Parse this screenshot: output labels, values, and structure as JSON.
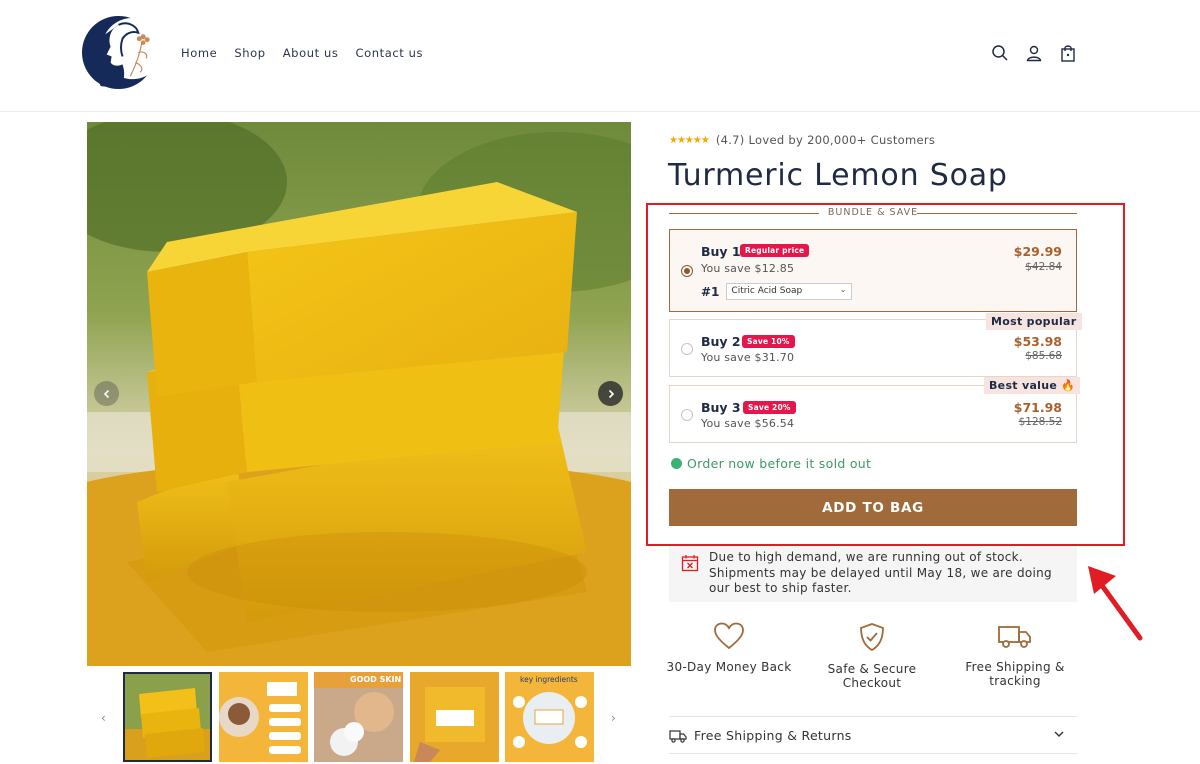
{
  "header": {
    "nav": [
      "Home",
      "Shop",
      "About us",
      "Contact us"
    ],
    "icons": [
      "search-icon",
      "account-icon",
      "bag-icon"
    ]
  },
  "product": {
    "rating": "(4.7) Loved by 200,000+ Customers",
    "stars": "★★★★★",
    "title": "Turmeric Lemon Soap"
  },
  "bundle": {
    "header": "BUNDLE & SAVE",
    "options": [
      {
        "name": "Buy 1",
        "badge": "Regular price",
        "save": "You save $12.85",
        "price": "$29.99",
        "old_price": "$42.84",
        "selected": true,
        "variant_num": "#1",
        "variant_value": "Citric Acid Soap"
      },
      {
        "name": "Buy 2",
        "badge": "Save 10%",
        "save": "You save $31.70",
        "price": "$53.98",
        "old_price": "$85.68",
        "tag": "Most popular"
      },
      {
        "name": "Buy 3",
        "badge": "Save 20%",
        "save": "You save $56.54",
        "price": "$71.98",
        "old_price": "$128.52",
        "tag": "Best value 🔥"
      }
    ]
  },
  "stock_text": "Order now before it sold out",
  "add_to_bag": "ADD TO BAG",
  "notice": "Due to high demand, we are running out of stock. Shipments may be delayed until May 18, we are doing our best to ship faster.",
  "features": [
    {
      "label": "30-Day Money Back",
      "icon": "heart-icon"
    },
    {
      "label": "Safe & Secure Checkout",
      "icon": "shield-check-icon"
    },
    {
      "label": "Free Shipping & tracking",
      "icon": "truck-icon"
    }
  ],
  "accordion": {
    "label": "Free Shipping & Returns"
  },
  "thumbnails": {
    "labels": [
      "GOOD SKIN",
      "key ingredients"
    ]
  },
  "colors": {
    "accent": "#a06a3b",
    "price": "#a8612d",
    "badge": "#e3174b",
    "stock": "#3bb273",
    "highlight": "#e01d24"
  }
}
